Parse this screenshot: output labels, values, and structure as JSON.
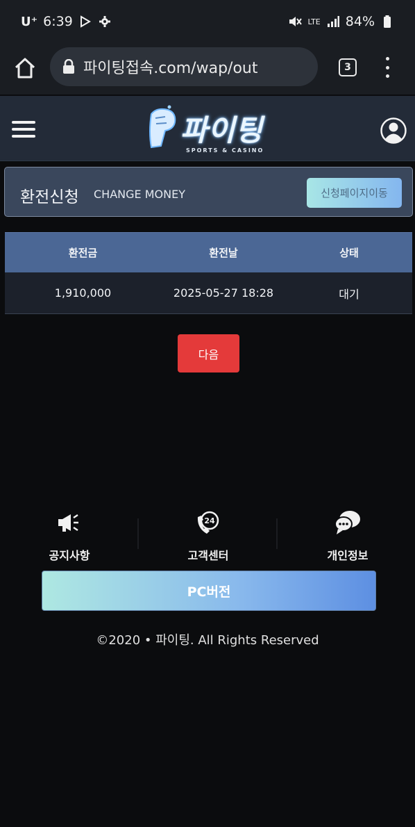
{
  "status_bar": {
    "carrier": "U⁺",
    "time": "6:39",
    "network": "LTE",
    "battery": "84%"
  },
  "browser": {
    "url": "파이팅접속.com/wap/out",
    "tab_count": "3"
  },
  "header": {
    "logo_text": "파이팅",
    "logo_sub": "SPORTS & CASINO"
  },
  "request": {
    "title": "환전신청",
    "subtitle": "CHANGE MONEY",
    "button_label": "신청페이지이동"
  },
  "table": {
    "headers": [
      "환전금",
      "환전날",
      "상태"
    ],
    "rows": [
      [
        "1,910,000",
        "2025-05-27 18:28",
        "대기"
      ]
    ]
  },
  "next_button": "다음",
  "footer_nav": [
    {
      "label": "공지사항",
      "icon": "megaphone-icon"
    },
    {
      "label": "고객센터",
      "icon": "phone-24-icon"
    },
    {
      "label": "개인정보",
      "icon": "chat-bubbles-icon"
    }
  ],
  "pc_button": "PC버전",
  "copyright": "©2020 • 파이팅. All Rights Reserved",
  "colors": {
    "accent_red": "#e43a3a",
    "table_header": "#4b6795",
    "panel": "#3a475c"
  }
}
